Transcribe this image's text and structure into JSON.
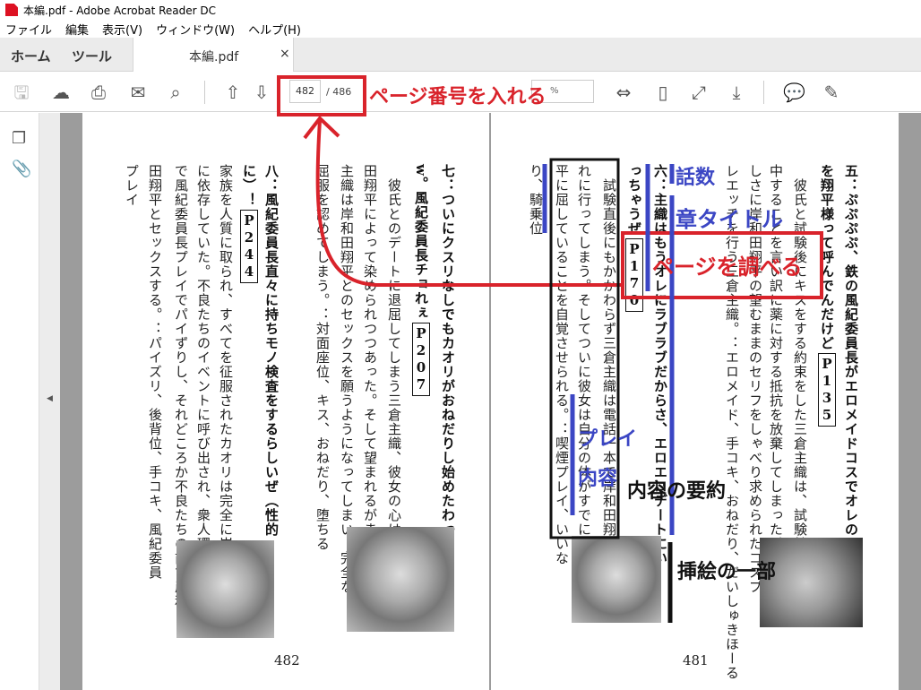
{
  "window": {
    "title": "本編.pdf - Adobe Acrobat Reader DC"
  },
  "menu": [
    "ファイル",
    "編集",
    "表示(V)",
    "ウィンドウ(W)",
    "ヘルプ(H)"
  ],
  "tabs": {
    "home": "ホーム",
    "tools": "ツール",
    "document": "本編.pdf",
    "close": "×"
  },
  "toolbar": {
    "current_page": "482",
    "total_pages": "/ 486",
    "zoom": "%"
  },
  "icons": [
    "save-icon",
    "cloud-upload-icon",
    "print-icon",
    "mail-icon",
    "search-icon",
    "arrow-up-icon",
    "arrow-down-icon",
    "fit-width-icon",
    "fit-page-icon",
    "full-screen-icon",
    "read-mode-icon",
    "comment-icon",
    "highlight-icon",
    "pages-icon",
    "paperclip-icon"
  ],
  "left_page": {
    "number": "482",
    "columns": [
      {
        "t": "七：ついにクスリなしでもカオリがおねだりし始めたわっ",
        "bold": true
      },
      {
        "t": "w。風紀委員長チョれぇ",
        "p": "P207",
        "bold": true
      },
      {
        "t": "　彼氏とのデートに退屈してしまう三倉主織、彼女の心はすでに岸和"
      },
      {
        "t": "田翔平によって染められつつあった。そして望まれるがままに三倉"
      },
      {
        "t": "主織は岸和田翔平とのセックスを願うようになってしまい、完全な"
      },
      {
        "t": "屈服を認めてしまう。：対面座位、キス、おねだり、堕ちる"
      },
      {
        "t": "八：風紀委員長直々に持ちモノ検査をするらしいぜ（性的",
        "bold": true
      },
      {
        "t": "に）！",
        "p": "P244",
        "bold": true
      },
      {
        "t": "家族を人質に取られ、すべてを征服されたカオリは完全に岸和田翔平"
      },
      {
        "t": "に依存していた。不良たちのイベントに呼び出され、衆人環視のもと"
      },
      {
        "t": "で風紀委員長プレイでパイずりし、それどころか不良たちの前で岸和"
      },
      {
        "t": "田翔平とセックスする。：パイズリ、後背位、手コキ、風紀委員"
      },
      {
        "t": "プレイ"
      }
    ]
  },
  "right_page": {
    "number": "481",
    "columns": [
      {
        "t": "五：ぷぷぷぷ、鉄の風紀委員長がエロメイドコスでオレのこと",
        "bold": true
      },
      {
        "t": "を翔平様って呼んでんだけど",
        "p": "P135",
        "bold": true
      },
      {
        "t": "　彼氏と試験後にキスをする約束をした三倉主織は、試験勉強に集"
      },
      {
        "t": "中することを言い訳に薬に対する抵抗を放棄してしまった。薬物欲"
      },
      {
        "t": "しさに岸和田翔平の望むままのセリフをしゃべり求められたコスプ"
      },
      {
        "t": "レエッチを行う三倉主織。：エロメイド、手コキ、おねだり、だいしゅきほーる"
      },
      {
        "t": "六：主織はもうオレにラブラブだからさ、エロエロデートにい",
        "bold": true
      },
      {
        "t": "っちゃうぜ",
        "p": "P170",
        "bold": true
      },
      {
        "t": "　試験直後にもかかわらず三倉主織は電話一本で岸和田翔平に抱か"
      },
      {
        "t": "れに行ってしまう。そしてついに彼女は自分の体がすでに岸和田翔"
      },
      {
        "t": "平に屈していることを自覚させられる。：喫煙プレイ、いいな"
      },
      {
        "t": "り、騎乗位"
      }
    ]
  },
  "annotations": {
    "enter_page": "ページ番号を入れる",
    "check_page": "ページを調べる",
    "episode": "話数",
    "chapter_title": "章タイトル",
    "play_content_1": "プレイ",
    "play_content_2": "内容",
    "summary": "内容の要約",
    "illustration": "挿絵の一部"
  },
  "colors": {
    "annotation_red": "#d9232b",
    "annotation_blue": "#3b46c4",
    "annotation_black": "#111111"
  }
}
